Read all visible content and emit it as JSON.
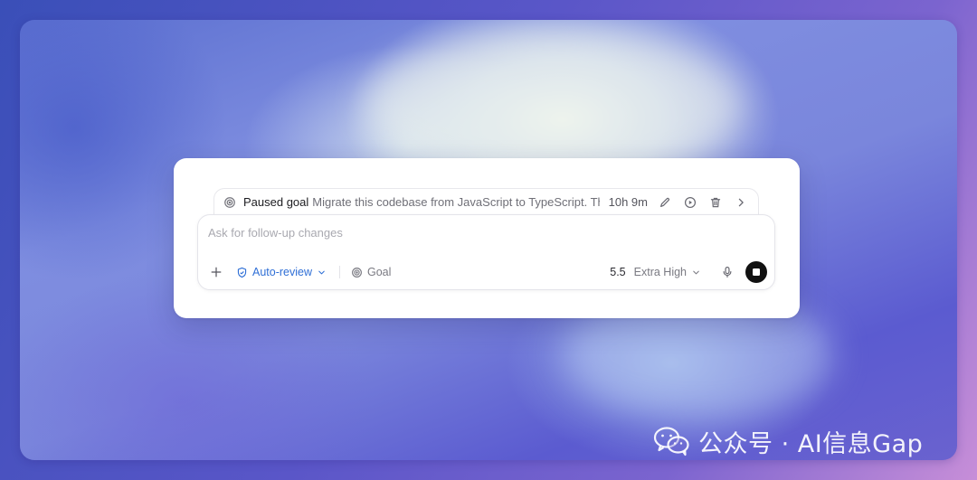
{
  "goal_bar": {
    "status": "Paused goal",
    "description": "Migrate this codebase from JavaScript to TypeScript. Th...",
    "elapsed": "10h 9m"
  },
  "composer": {
    "placeholder": "Ask for follow-up changes",
    "review_mode": "Auto-review",
    "goal_label": "Goal",
    "model_version": "5.5",
    "reasoning_effort": "Extra High"
  },
  "watermark": {
    "text": "公众号 · AI信息Gap"
  },
  "colors": {
    "accent": "#2f6fd6",
    "stop_button": "#111111",
    "card_bg": "#ffffff"
  },
  "icons": {
    "goal": "target-icon",
    "edit": "pencil-icon",
    "resume": "play-circle-icon",
    "delete": "trash-icon",
    "expand": "chevron-right-icon",
    "add": "plus-icon",
    "review": "shield-icon",
    "effort_dropdown": "chevron-down-icon",
    "mic": "microphone-icon",
    "stop": "stop-icon",
    "brand": "wechat-icon"
  }
}
